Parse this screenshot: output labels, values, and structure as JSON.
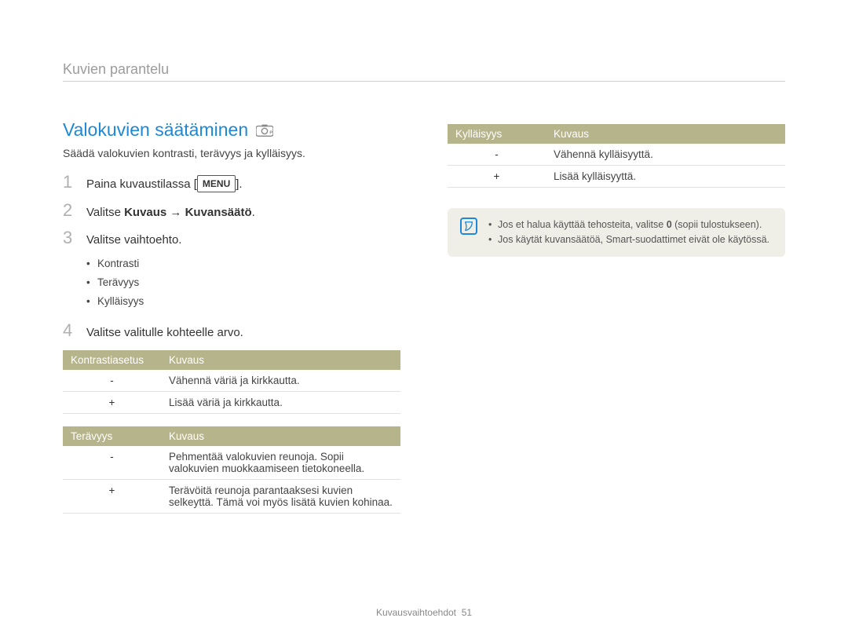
{
  "page_label": "Kuvien parantelu",
  "section_title": "Valokuvien säätäminen",
  "intro": "Säädä valokuvien kontrasti, terävyys ja kylläisyys.",
  "menu_label": "MENU",
  "steps": {
    "s1_prefix": "Paina kuvaustilassa [",
    "s1_suffix": "].",
    "s2_prefix": "Valitse ",
    "s2_bold": "Kuvaus → Kuvansäätö",
    "s2_suffix": ".",
    "s3": "Valitse vaihtoehto.",
    "bullets": [
      "Kontrasti",
      "Terävyys",
      "Kylläisyys"
    ],
    "s4": "Valitse valitulle kohteelle arvo."
  },
  "tables": {
    "contrast": {
      "h1": "Kontrastiasetus",
      "h2": "Kuvaus",
      "rows": [
        {
          "key": "-",
          "desc": "Vähennä väriä ja kirkkautta."
        },
        {
          "key": "+",
          "desc": "Lisää väriä ja kirkkautta."
        }
      ]
    },
    "sharpness": {
      "h1": "Terävyys",
      "h2": "Kuvaus",
      "rows": [
        {
          "key": "-",
          "desc": "Pehmentää valokuvien reunoja. Sopii valokuvien muokkaamiseen tietokoneella."
        },
        {
          "key": "+",
          "desc": "Terävöitä reunoja parantaaksesi kuvien selkeyttä. Tämä voi myös lisätä kuvien kohinaa."
        }
      ]
    },
    "saturation": {
      "h1": "Kylläisyys",
      "h2": "Kuvaus",
      "rows": [
        {
          "key": "-",
          "desc": "Vähennä kylläisyyttä."
        },
        {
          "key": "+",
          "desc": "Lisää kylläisyyttä."
        }
      ]
    }
  },
  "notes": {
    "n1_prefix": "Jos et halua käyttää tehosteita, valitse ",
    "n1_bold": "0",
    "n1_suffix": " (sopii tulostukseen).",
    "n2": "Jos käytät kuvansäätöä, Smart-suodattimet eivät ole käytössä."
  },
  "footer_label": "Kuvausvaihtoehdot",
  "footer_page": "51"
}
